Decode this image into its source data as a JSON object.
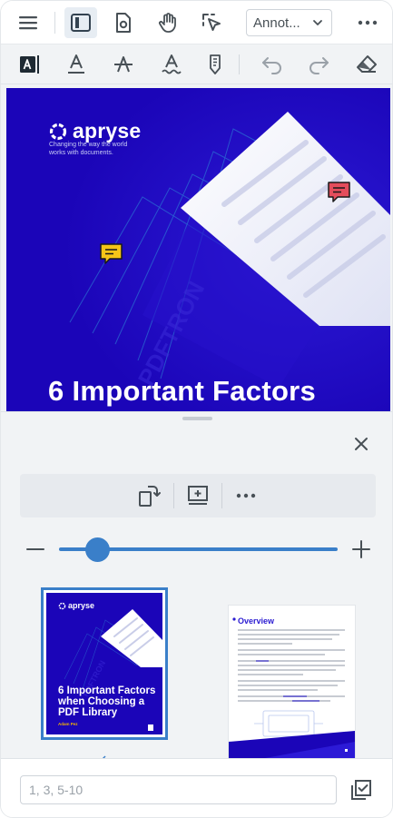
{
  "header": {
    "mode_selector": {
      "value": "Annot...",
      "icon": "chevron-down-icon"
    },
    "buttons": [
      {
        "name": "menu",
        "icon": "hamburger-icon"
      },
      {
        "name": "left-panel",
        "icon": "sidebar-panel-icon",
        "active": true
      },
      {
        "name": "page-settings",
        "icon": "document-gear-icon"
      },
      {
        "name": "pan",
        "icon": "hand-icon"
      },
      {
        "name": "select",
        "icon": "cursor-selection-icon"
      },
      {
        "name": "more",
        "icon": "more-horizontal-icon"
      }
    ]
  },
  "tools": [
    {
      "name": "free-text",
      "icon": "text-box-icon",
      "active": true
    },
    {
      "name": "underline",
      "icon": "underline-icon"
    },
    {
      "name": "strikeout",
      "icon": "strikeout-icon"
    },
    {
      "name": "squiggly",
      "icon": "squiggly-icon"
    },
    {
      "name": "sticky",
      "icon": "sticky-note-icon"
    },
    {
      "name": "undo",
      "icon": "undo-icon"
    },
    {
      "name": "redo",
      "icon": "redo-icon"
    },
    {
      "name": "eraser",
      "icon": "eraser-icon"
    }
  ],
  "document": {
    "logo_text": "apryse",
    "tagline": "Changing the way the world works with documents.",
    "title": "6 Important Factors",
    "watermark": "PDFTRON",
    "comment_colors": {
      "red": "#e44d5c",
      "yellow": "#f5c518"
    }
  },
  "panel": {
    "operations": [
      {
        "name": "rotate",
        "icon": "rotate-page-icon"
      },
      {
        "name": "insert",
        "icon": "insert-page-icon"
      },
      {
        "name": "more",
        "icon": "more-horizontal-icon"
      }
    ],
    "zoom": {
      "level": 0.1,
      "minus_icon": "minus-icon",
      "plus_icon": "plus-icon"
    },
    "thumbnails": [
      {
        "logo": "apryse",
        "title": "6 Important Factors when Choosing a PDF Library",
        "author": "Adam Pez",
        "selected": true
      },
      {
        "heading": "Overview",
        "selected": false
      }
    ],
    "page_input": {
      "placeholder": "1, 3, 5-10",
      "value": ""
    }
  },
  "colors": {
    "accent": "#3a7fc9",
    "cover": "#1b05b8",
    "icon": "#485056"
  }
}
